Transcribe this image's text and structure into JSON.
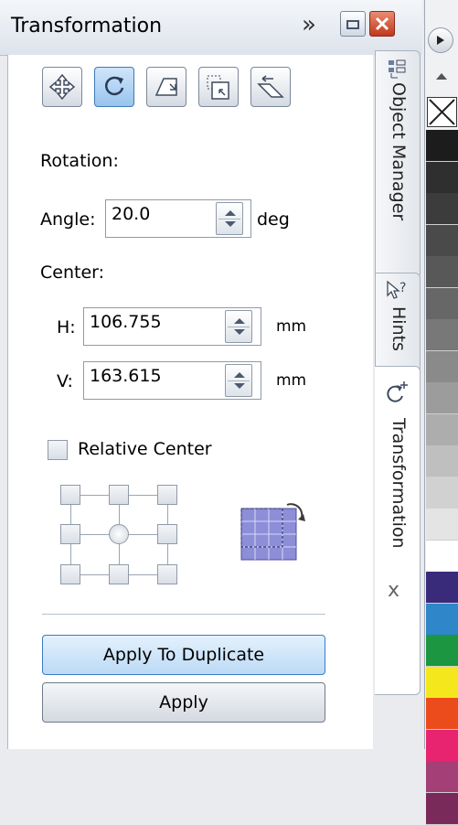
{
  "window": {
    "title": "Transformation"
  },
  "modes": [
    "position",
    "rotation",
    "scale-and-mirror",
    "size",
    "skew"
  ],
  "rotation": {
    "section_label": "Rotation:",
    "angle_label": "Angle:",
    "angle_value": "20.0",
    "angle_unit": "deg"
  },
  "center": {
    "section_label": "Center:",
    "h_label": "H:",
    "h_value": "106.755",
    "h_unit": "mm",
    "v_label": "V:",
    "v_value": "163.615",
    "v_unit": "mm"
  },
  "relative_center": {
    "label": "Relative Center",
    "checked": false
  },
  "buttons": {
    "apply_to_duplicate": "Apply To Duplicate",
    "apply": "Apply"
  },
  "tabs": [
    "Object Manager",
    "Hints",
    "Transformation"
  ],
  "tab_close": "x",
  "palette_colors": [
    "#1c1c1c",
    "#2f2f2f",
    "#3c3c3c",
    "#4a4a4a",
    "#585858",
    "#676767",
    "#787878",
    "#8a8a8a",
    "#9c9c9c",
    "#adadad",
    "#bfbfbf",
    "#d1d1d1",
    "#e4e4e4",
    "#ffffff",
    "#3a2a7a",
    "#2f86c8",
    "#1c9640",
    "#f4e81c",
    "#ec4b1c",
    "#e8236f",
    "#a43f77",
    "#7a2a5a"
  ]
}
